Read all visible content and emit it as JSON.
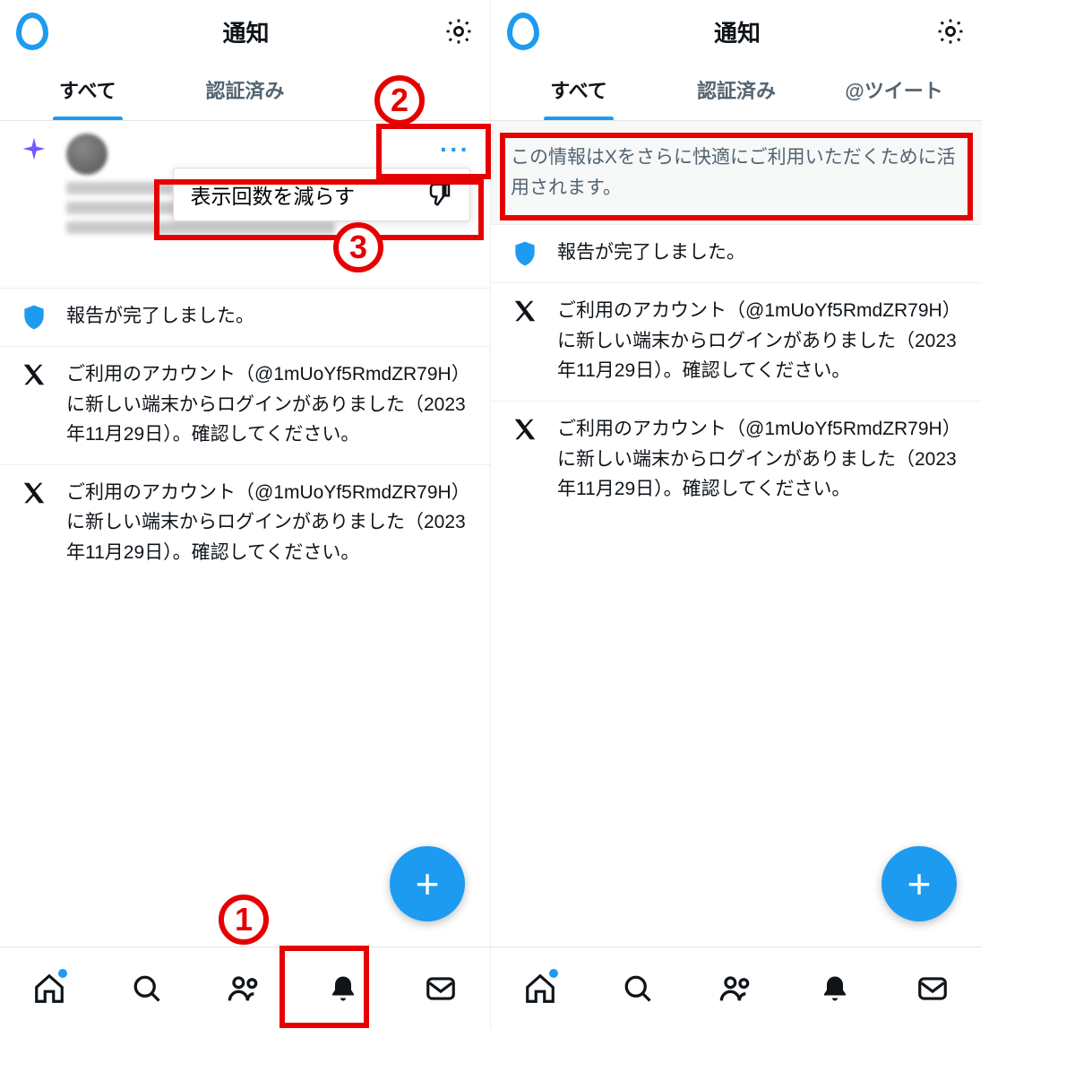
{
  "header": {
    "title": "通知"
  },
  "tabs": {
    "left": [
      "すべて",
      "認証済み",
      "@ツ"
    ],
    "right": [
      "すべて",
      "認証済み",
      "@ツイート"
    ]
  },
  "popup": {
    "reduce_label": "表示回数を減らす"
  },
  "banner": {
    "text": "この情報はXをさらに快適にご利用いただくために活用されます。"
  },
  "notifications": {
    "report_done": "報告が完了しました。",
    "login_alert": "ご利用のアカウント（@1mUoYf5RmdZR79H）に新しい端末からログインがありました（2023年11月29日）。確認してください。"
  },
  "callouts": {
    "c1": "1",
    "c2": "2",
    "c3": "3"
  }
}
